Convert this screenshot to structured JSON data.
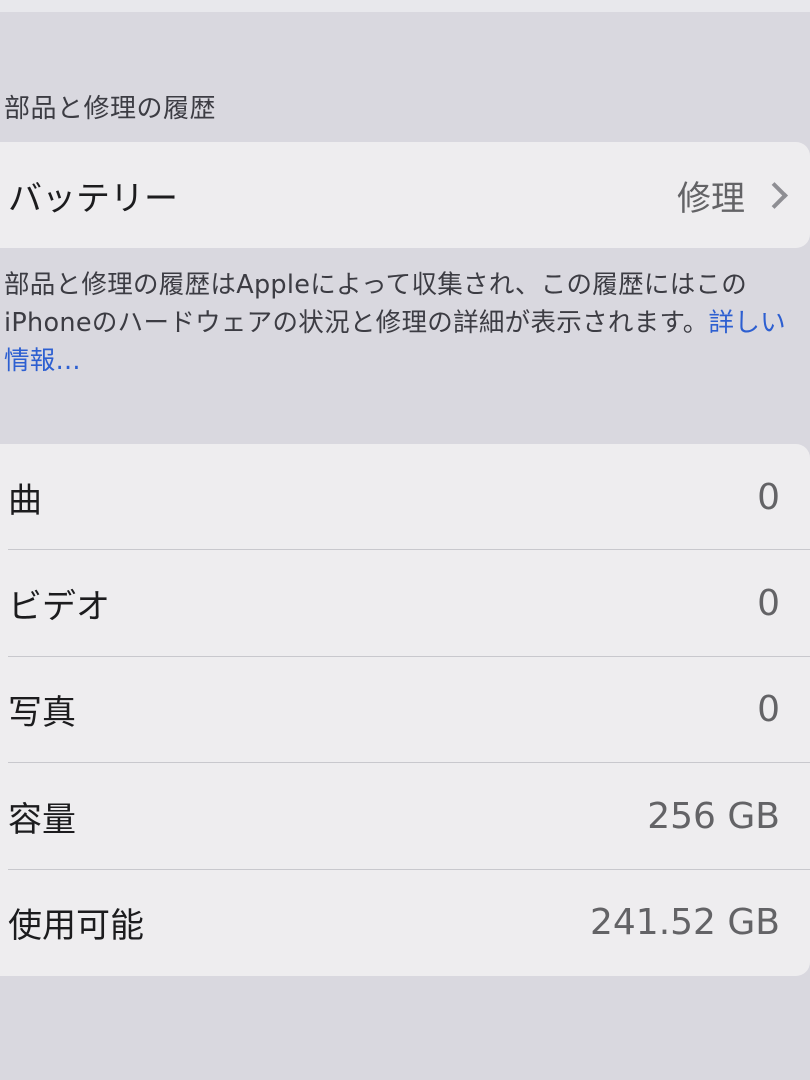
{
  "section_header": "部品と修理の履歴",
  "battery_row": {
    "label": "バッテリー",
    "value": "修理"
  },
  "footer": {
    "text": "部品と修理の履歴はAppleによって収集され、この履歴にはこのiPhoneのハードウェアの状況と修理の詳細が表示されます。",
    "link": "詳しい情報..."
  },
  "info_rows": [
    {
      "label": "曲",
      "value": "0"
    },
    {
      "label": "ビデオ",
      "value": "0"
    },
    {
      "label": "写真",
      "value": "0"
    },
    {
      "label": "容量",
      "value": "256 GB"
    },
    {
      "label": "使用可能",
      "value": "241.52 GB"
    }
  ],
  "colors": {
    "background": "#d9d8df",
    "card": "#eeedef",
    "link": "#2d5fd1"
  }
}
